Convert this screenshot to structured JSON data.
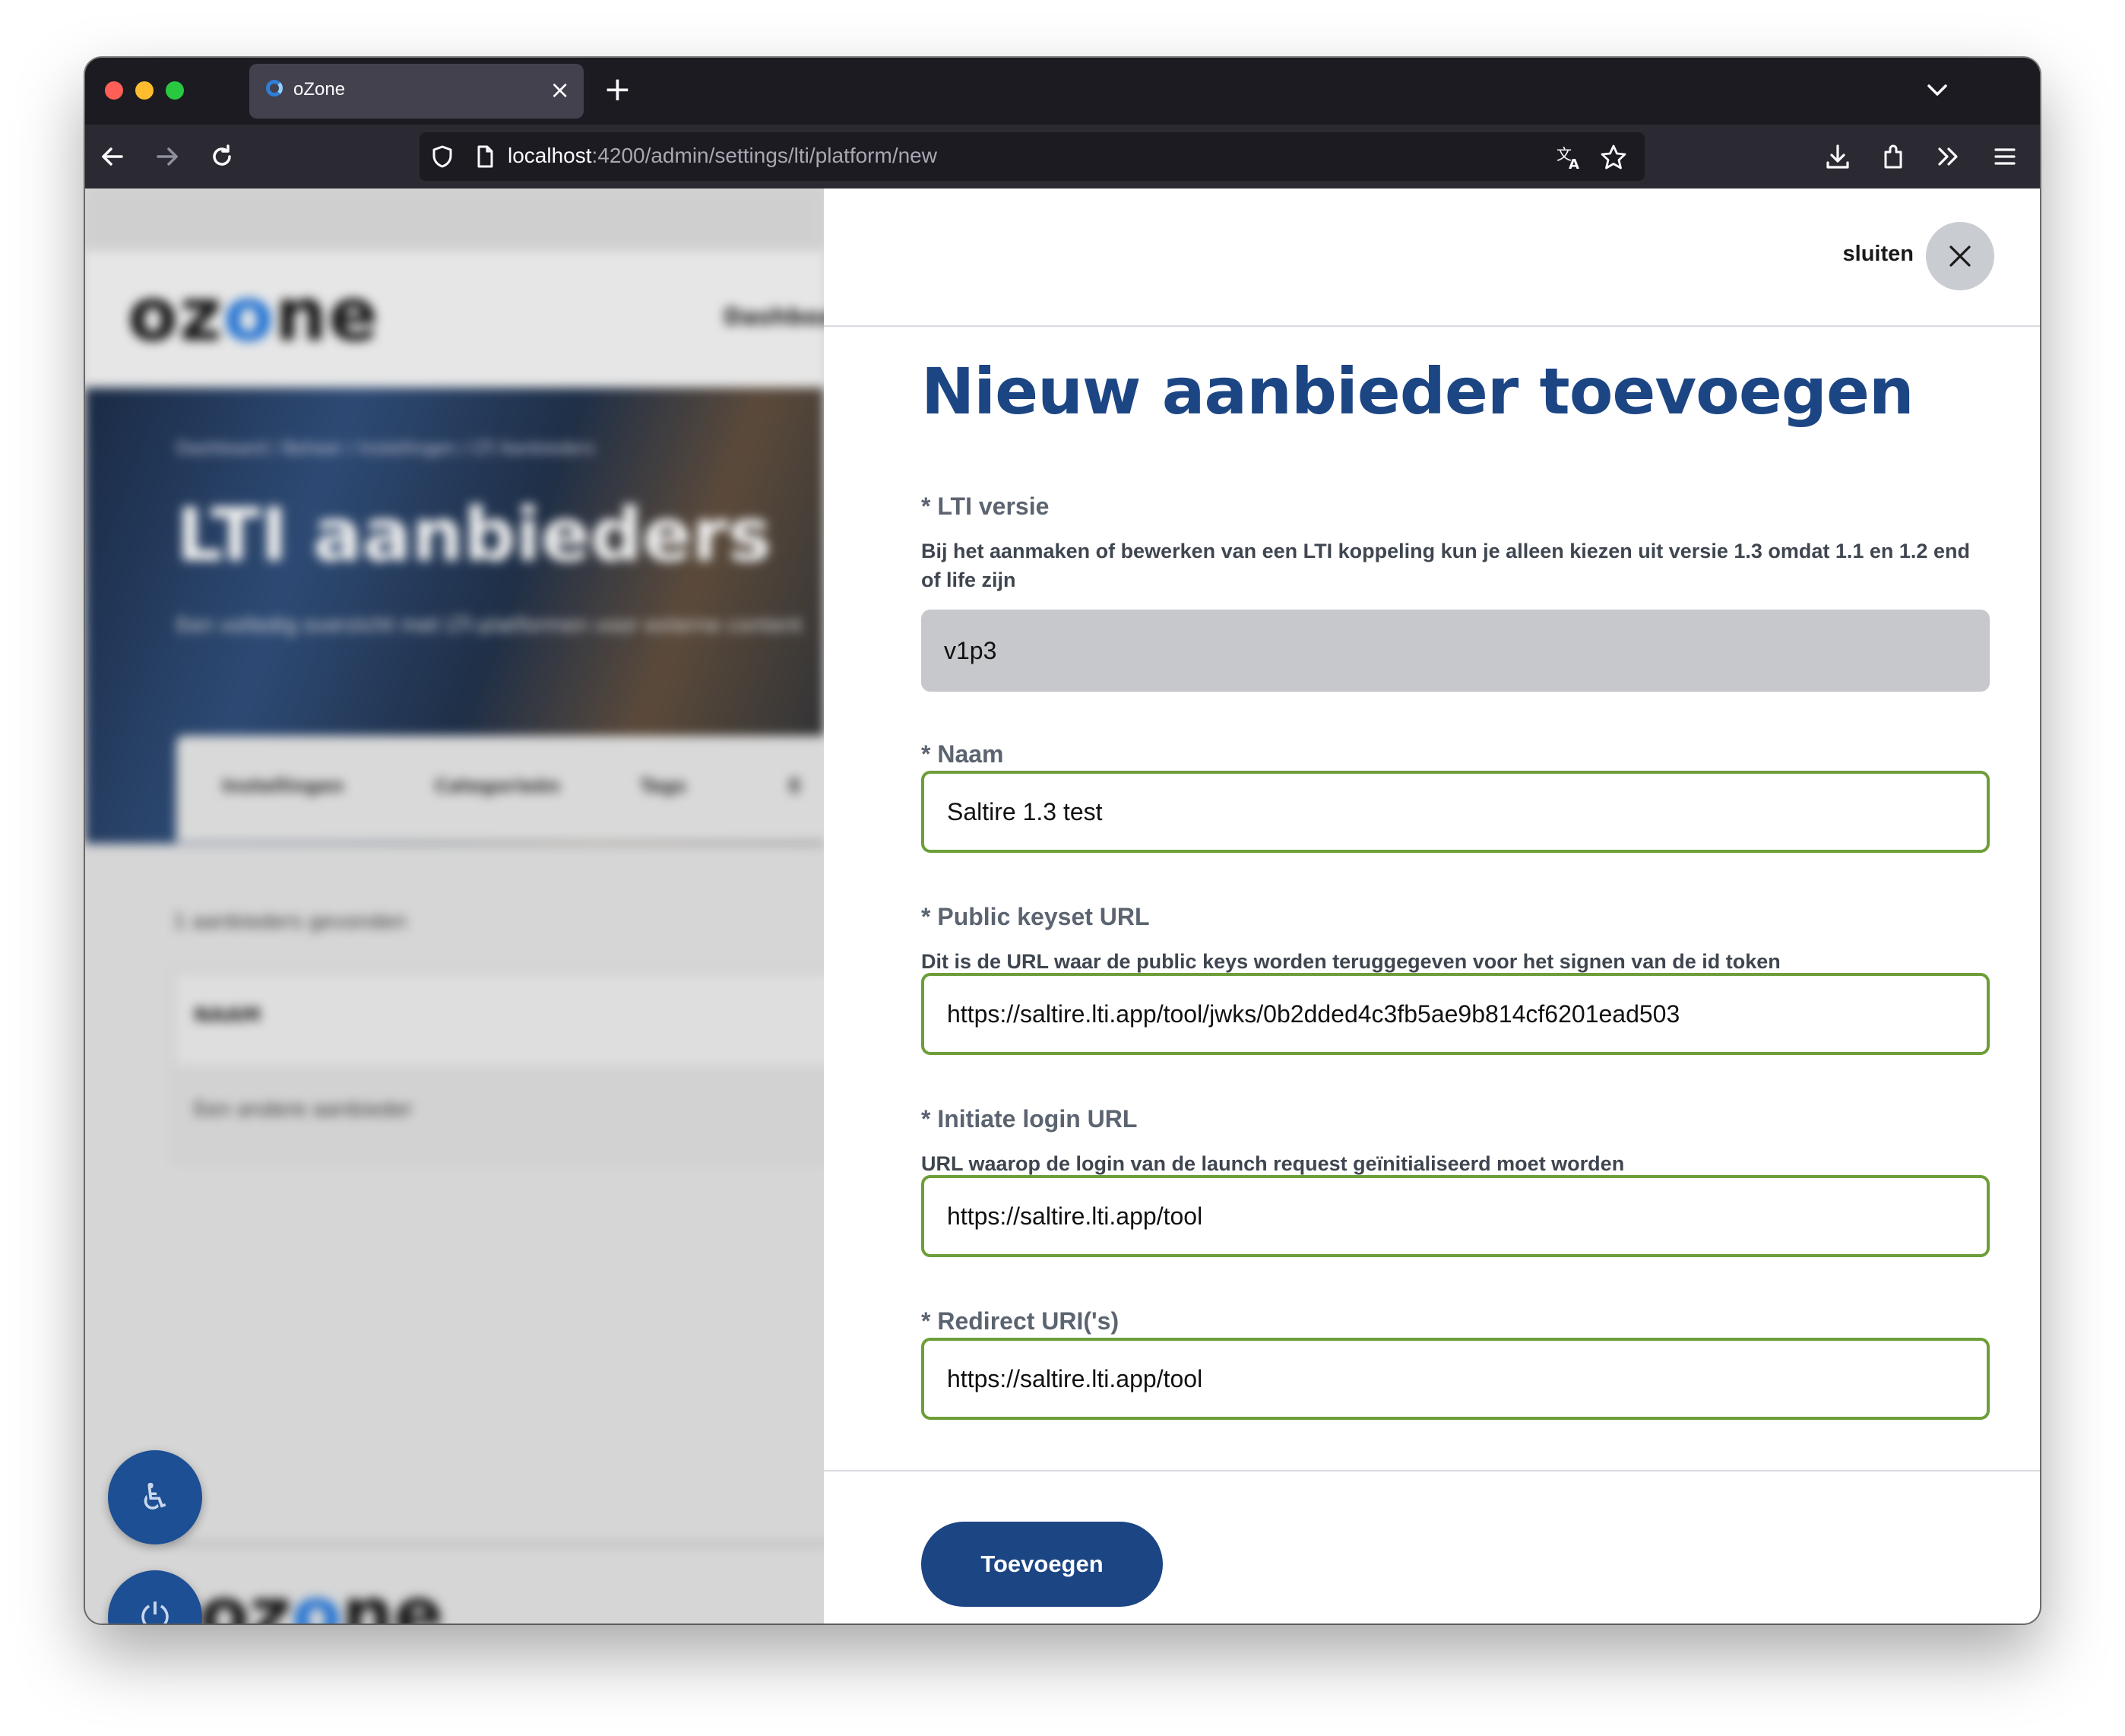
{
  "browser": {
    "tab_title": "oZone",
    "tab_close": "×",
    "new_tab": "+",
    "url_host": "localhost",
    "url_path": ":4200/admin/settings/lti/platform/new"
  },
  "background_page": {
    "logo": [
      "oz",
      "o",
      "ne"
    ],
    "nav_item": "Dashboa",
    "breadcrumbs": "Dashboard / Beheer / Instellingen / LTI Aanbieders",
    "title": "LTI aanbieders",
    "subtitle": "Een volledig overzicht met LTI-platformen voor externe content",
    "tabs": [
      "Instellingen",
      "Categorieën",
      "Tags",
      "E"
    ],
    "result_count": "1 aanbieders gevonden",
    "table_header": "NAAM",
    "table_row": "Een andere aanbieder",
    "footer_logo": [
      "oz",
      "o",
      "ne"
    ]
  },
  "panel": {
    "close_label": "sluiten",
    "title": "Nieuw aanbieder toevoegen",
    "fields": [
      {
        "label": "* LTI versie",
        "help": "Bij het aanmaken of bewerken van een LTI koppeling kun je alleen kiezen uit versie 1.3 omdat 1.1 en 1.2 end of life zijn",
        "value": "v1p3",
        "disabled": true
      },
      {
        "label": "* Naam",
        "value": "Saltire 1.3 test"
      },
      {
        "label": "* Public keyset URL",
        "help": "Dit is de URL waar de public keys worden teruggegeven voor het signen van de id token",
        "value": "https://saltire.lti.app/tool/jwks/0b2dded4c3fb5ae9b814cf6201ead503"
      },
      {
        "label": "* Initiate login URL",
        "help": "URL waarop de login van de launch request geïnitialiseerd moet worden",
        "value": "https://saltire.lti.app/tool"
      },
      {
        "label": "* Redirect URI('s)",
        "value": "https://saltire.lti.app/tool"
      }
    ],
    "submit_label": "Toevoegen",
    "colors": {
      "title": "#1c4583",
      "input_border": "#6e9e3a",
      "button": "#1c4583"
    }
  }
}
